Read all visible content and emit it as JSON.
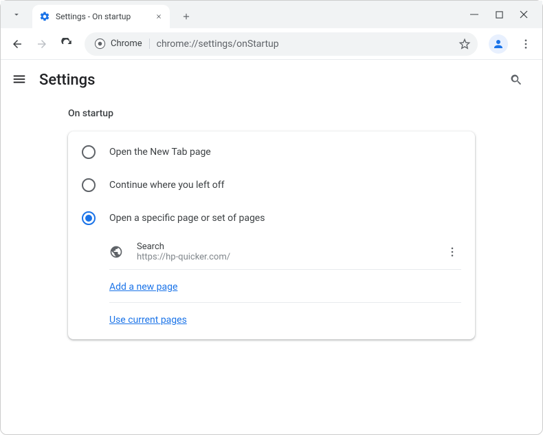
{
  "tab": {
    "title": "Settings - On startup"
  },
  "omnibox": {
    "chip": "Chrome",
    "url": "chrome://settings/onStartup"
  },
  "header": {
    "title": "Settings"
  },
  "section": {
    "title": "On startup"
  },
  "options": {
    "new_tab": "Open the New Tab page",
    "continue": "Continue where you left off",
    "specific": "Open a specific page or set of pages"
  },
  "startup_page": {
    "name": "Search",
    "url": "https://hp-quicker.com/"
  },
  "links": {
    "add": "Add a new page",
    "current": "Use current pages"
  }
}
